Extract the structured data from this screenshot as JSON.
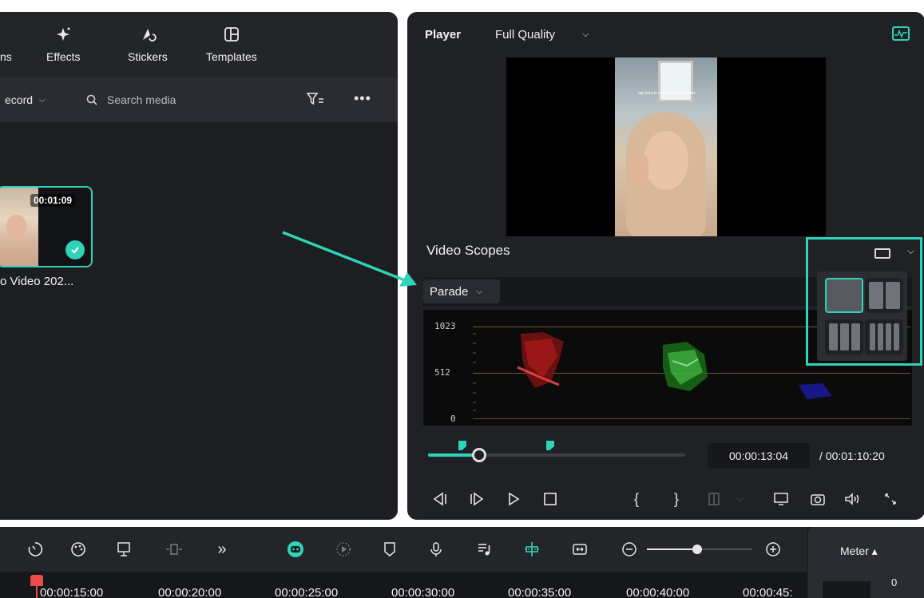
{
  "media_panel": {
    "tabs": [
      {
        "label": "ns",
        "icon": "elements-icon"
      },
      {
        "label": "Effects",
        "icon": "sparkle-icon"
      },
      {
        "label": "Stickers",
        "icon": "sticker-icon"
      },
      {
        "label": "Templates",
        "icon": "template-icon"
      }
    ],
    "record_label": "ecord",
    "search_placeholder": "Search media",
    "more_label": "•••",
    "clip": {
      "duration": "00:01:09",
      "name": "o Video 202..."
    }
  },
  "player": {
    "label": "Player",
    "quality": "Full Quality",
    "video_caption": "tap here to see the tutorial video",
    "scopes_title": "Video Scopes",
    "scope_mode": "Parade",
    "scope_levels": [
      "1023",
      "512",
      "0"
    ],
    "progress_fraction": 0.2,
    "current_time": "00:00:13:04",
    "total_time": "/ 00:01:10:20",
    "layout_options": [
      "single",
      "double",
      "triple",
      "quad"
    ]
  },
  "timeline": {
    "meter_label": "Meter ▴",
    "meter_value": "0",
    "ruler_labels": [
      "00:00:15:00",
      "00:00:20:00",
      "00:00:25:00",
      "00:00:30:00",
      "00:00:35:00",
      "00:00:40:00",
      "00:00:45:"
    ],
    "zoom_fraction": 0.48
  },
  "colors": {
    "accent": "#2fd3b8",
    "playhead": "#e94a4a",
    "panel": "#1f2125"
  }
}
